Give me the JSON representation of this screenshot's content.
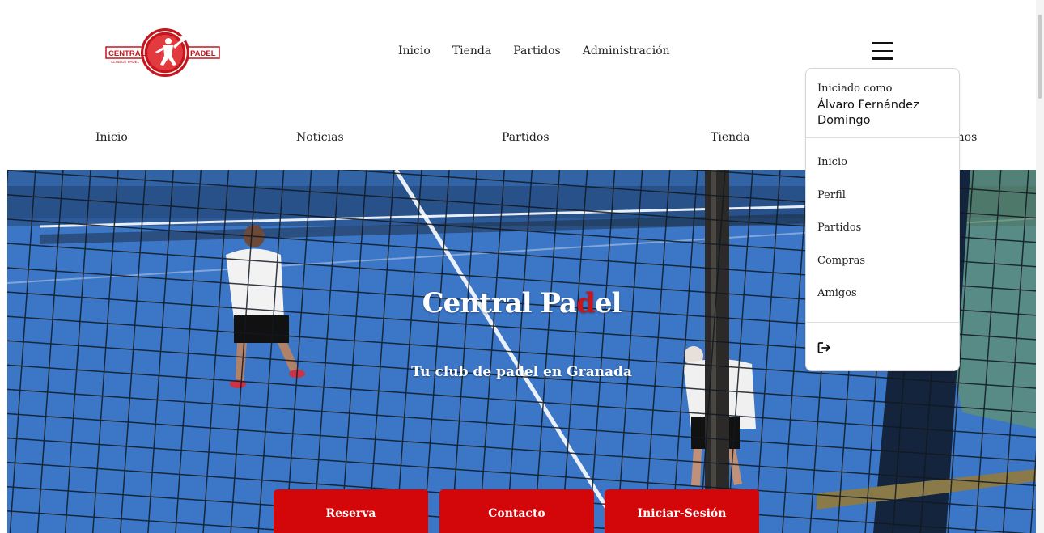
{
  "logo": {
    "left_text": "CENTRAL",
    "right_text": "PADEL",
    "tagline": "CLUB DE PADEL"
  },
  "top_nav": [
    "Inicio",
    "Tienda",
    "Partidos",
    "Administración"
  ],
  "menu_icon": "hamburger-icon",
  "secondary_nav": [
    "Inicio",
    "Noticias",
    "Partidos",
    "Tienda",
    "Contáctarnos"
  ],
  "hero": {
    "title_part1": "Central Pa",
    "title_red": "d",
    "title_part2": "el",
    "subtitle": "Tu club de padel en Granada",
    "buttons": [
      "Reserva",
      "Contacto",
      "Iniciar-Sesión"
    ]
  },
  "dropdown": {
    "label": "Iniciado como",
    "user": "Álvaro Fernández Domingo",
    "items": [
      "Inicio",
      "Perfil",
      "Partidos",
      "Compras",
      "Amigos"
    ],
    "logout_icon": "logout-icon"
  },
  "colors": {
    "accent_red": "#d3070a",
    "logo_red": "#c4161c",
    "court_blue": "#3d78c9"
  }
}
